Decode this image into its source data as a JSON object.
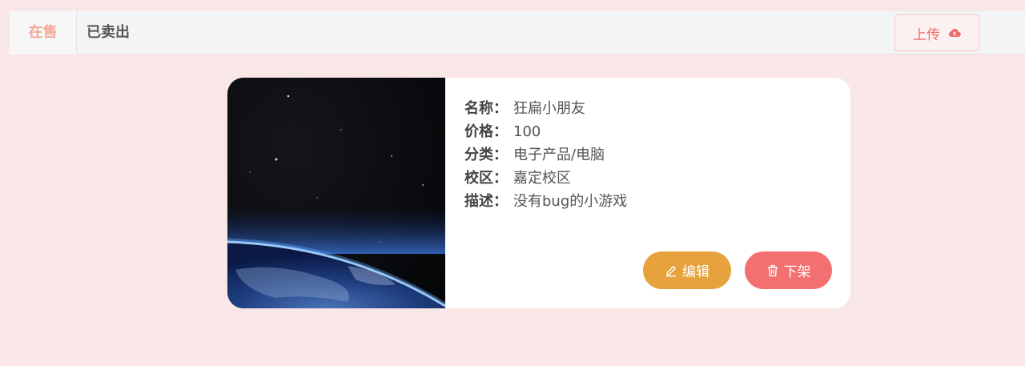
{
  "tabs": {
    "on_sale": "在售",
    "sold": "已卖出"
  },
  "toolbar": {
    "upload_label": "上传",
    "upload_icon": "cloud-upload-icon"
  },
  "product": {
    "image_alt": "earth-from-space",
    "fields": [
      {
        "label": "名称：",
        "value": "狂扁小朋友"
      },
      {
        "label": "价格：",
        "value": "100"
      },
      {
        "label": "分类：",
        "value": "电子产品/电脑"
      },
      {
        "label": "校区：",
        "value": "嘉定校区"
      },
      {
        "label": "描述：",
        "value": "没有bug的小游戏"
      }
    ],
    "edit_label": "编辑",
    "edit_icon": "edit-icon",
    "takedown_label": "下架",
    "takedown_icon": "trash-icon"
  },
  "colors": {
    "background": "#f9e6e6",
    "active_tab": "#f5a89a",
    "edit_button": "#e6a23c",
    "takedown_button": "#f36f70",
    "upload_text": "#ee6b6b"
  }
}
